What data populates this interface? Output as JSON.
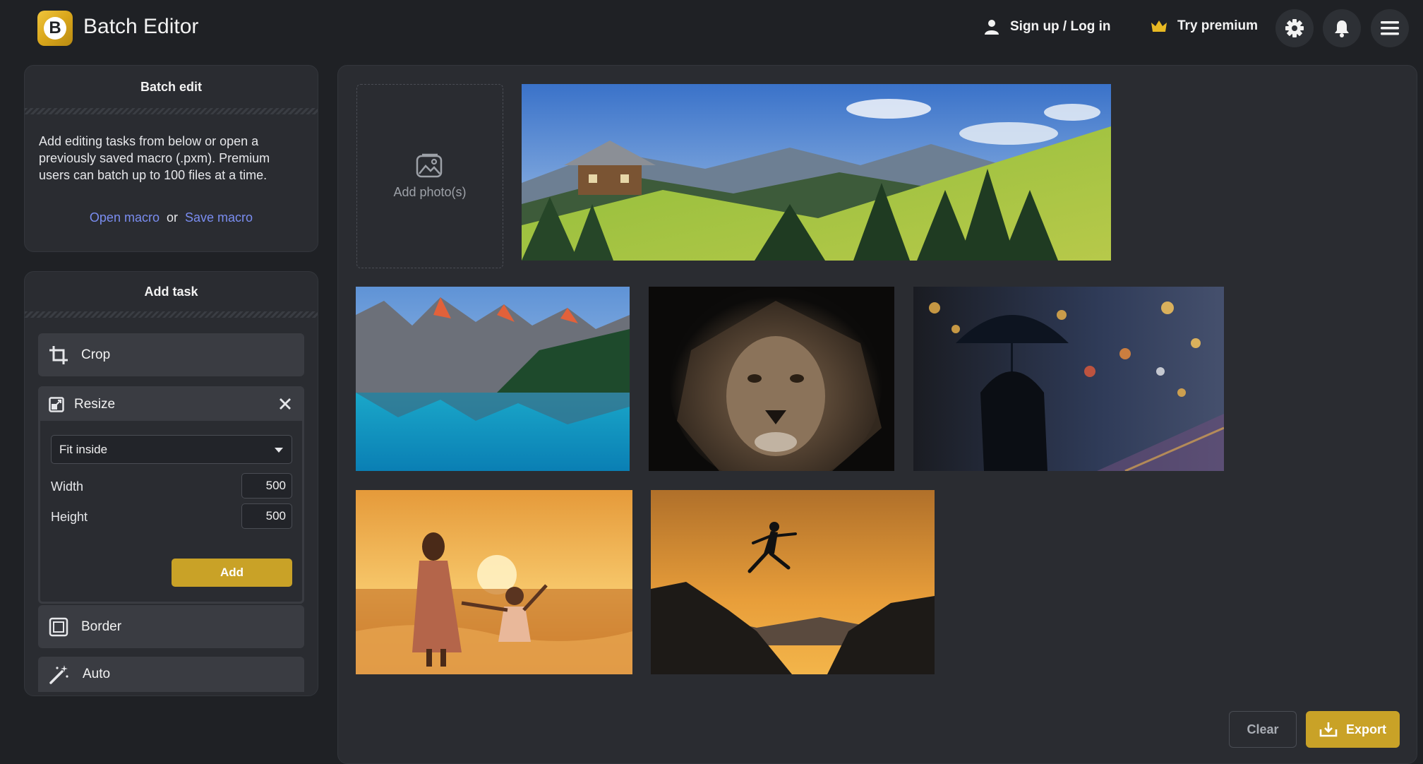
{
  "header": {
    "logo_letter": "B",
    "title": "Batch Editor",
    "signup_label": "Sign up / Log in",
    "premium_label": "Try premium"
  },
  "batch_panel": {
    "title": "Batch edit",
    "description": "Add editing tasks from below or open a previously saved macro (.pxm). Premium users can batch up to 100 files at a time.",
    "open_macro": "Open macro",
    "or": "or",
    "save_macro": "Save macro"
  },
  "task_panel": {
    "title": "Add task",
    "tasks": [
      {
        "label": "Crop",
        "icon": "crop-icon"
      },
      {
        "label": "Resize",
        "icon": "resize-icon"
      },
      {
        "label": "Border",
        "icon": "border-icon"
      },
      {
        "label": "Auto",
        "icon": "magic-wand-icon"
      }
    ],
    "resize": {
      "mode": "Fit inside",
      "width_label": "Width",
      "width_value": "500",
      "height_label": "Height",
      "height_value": "500",
      "add_label": "Add"
    }
  },
  "main": {
    "add_photo_label": "Add photo(s)",
    "photos": [
      {
        "name": "mountain-chalet"
      },
      {
        "name": "mountain-lake"
      },
      {
        "name": "lion"
      },
      {
        "name": "umbrella-night-street"
      },
      {
        "name": "mother-child-beach-sunset"
      },
      {
        "name": "runner-jump-sunset"
      }
    ],
    "clear_label": "Clear",
    "export_label": "Export"
  },
  "colors": {
    "background": "#1f2125",
    "panel": "#2a2c31",
    "accent": "#c9a227",
    "link": "#7a8df0"
  }
}
